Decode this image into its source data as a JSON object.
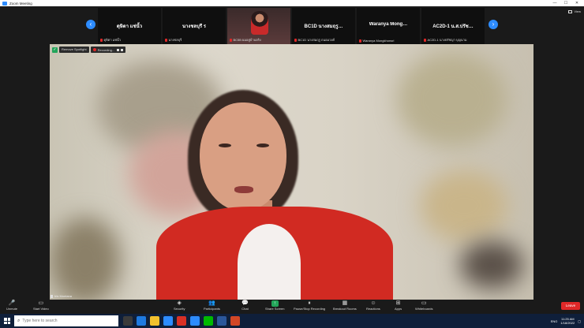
{
  "window": {
    "title": "Zoom Meeting",
    "minimize": "—",
    "maximize": "☐",
    "close": "✕",
    "view_label": "View"
  },
  "gallery": {
    "prev_arrow": "‹",
    "next_arrow": "›",
    "tiles": [
      {
        "name": "ดุษิตา แช่นั้ว",
        "label": "ดุษิตา แช่นั้ว",
        "has_video": false
      },
      {
        "name": "นางชลบุรี ร",
        "label": "นางชลบุรี",
        "has_video": false
      },
      {
        "name": "",
        "label": "BC5B ผมอยู่บ้านจริง",
        "has_video": true
      },
      {
        "name": "BC1D นางสมฤรู…",
        "label": "BC1D นางสมฤรู ถนอมวงศ์",
        "has_video": false
      },
      {
        "name": "Waranya Mong…",
        "label": "Waranya Mongkhonsri",
        "has_video": false
      },
      {
        "name": "AC2D-1 น.ส.ปรัช…",
        "label": "AC2D-1 นางปรัชญา บุญนาม",
        "has_video": false
      }
    ]
  },
  "spotlight": {
    "remove_label": "Remove Spotlight",
    "recording_label": "Recording…",
    "speaker_name": "Iris Montana"
  },
  "toolbar": {
    "items": [
      {
        "label": "Unmute",
        "icon": "microphone-muted-icon"
      },
      {
        "label": "Start Video",
        "icon": "video-off-icon"
      },
      {
        "label": "Security",
        "icon": "shield-icon"
      },
      {
        "label": "Participants",
        "icon": "participants-icon",
        "count": "174"
      },
      {
        "label": "Chat",
        "icon": "chat-icon"
      },
      {
        "label": "Share Screen",
        "icon": "share-screen-icon"
      },
      {
        "label": "Pause/Stop Recording",
        "icon": "recording-controls-icon"
      },
      {
        "label": "Breakout Rooms",
        "icon": "breakout-rooms-icon"
      },
      {
        "label": "Reactions",
        "icon": "reactions-icon"
      },
      {
        "label": "Apps",
        "icon": "apps-icon"
      },
      {
        "label": "Whiteboards",
        "icon": "whiteboard-icon"
      }
    ],
    "leave_label": "Leave"
  },
  "taskbar": {
    "search_placeholder": "Type here to search",
    "time": "11:25 AM",
    "date": "1/18/2022",
    "lang": "ENG"
  },
  "colors": {
    "accent": "#2d8cff",
    "leave": "#e02828",
    "share_green": "#23a55a",
    "taskbar": "#0f1f3a"
  }
}
